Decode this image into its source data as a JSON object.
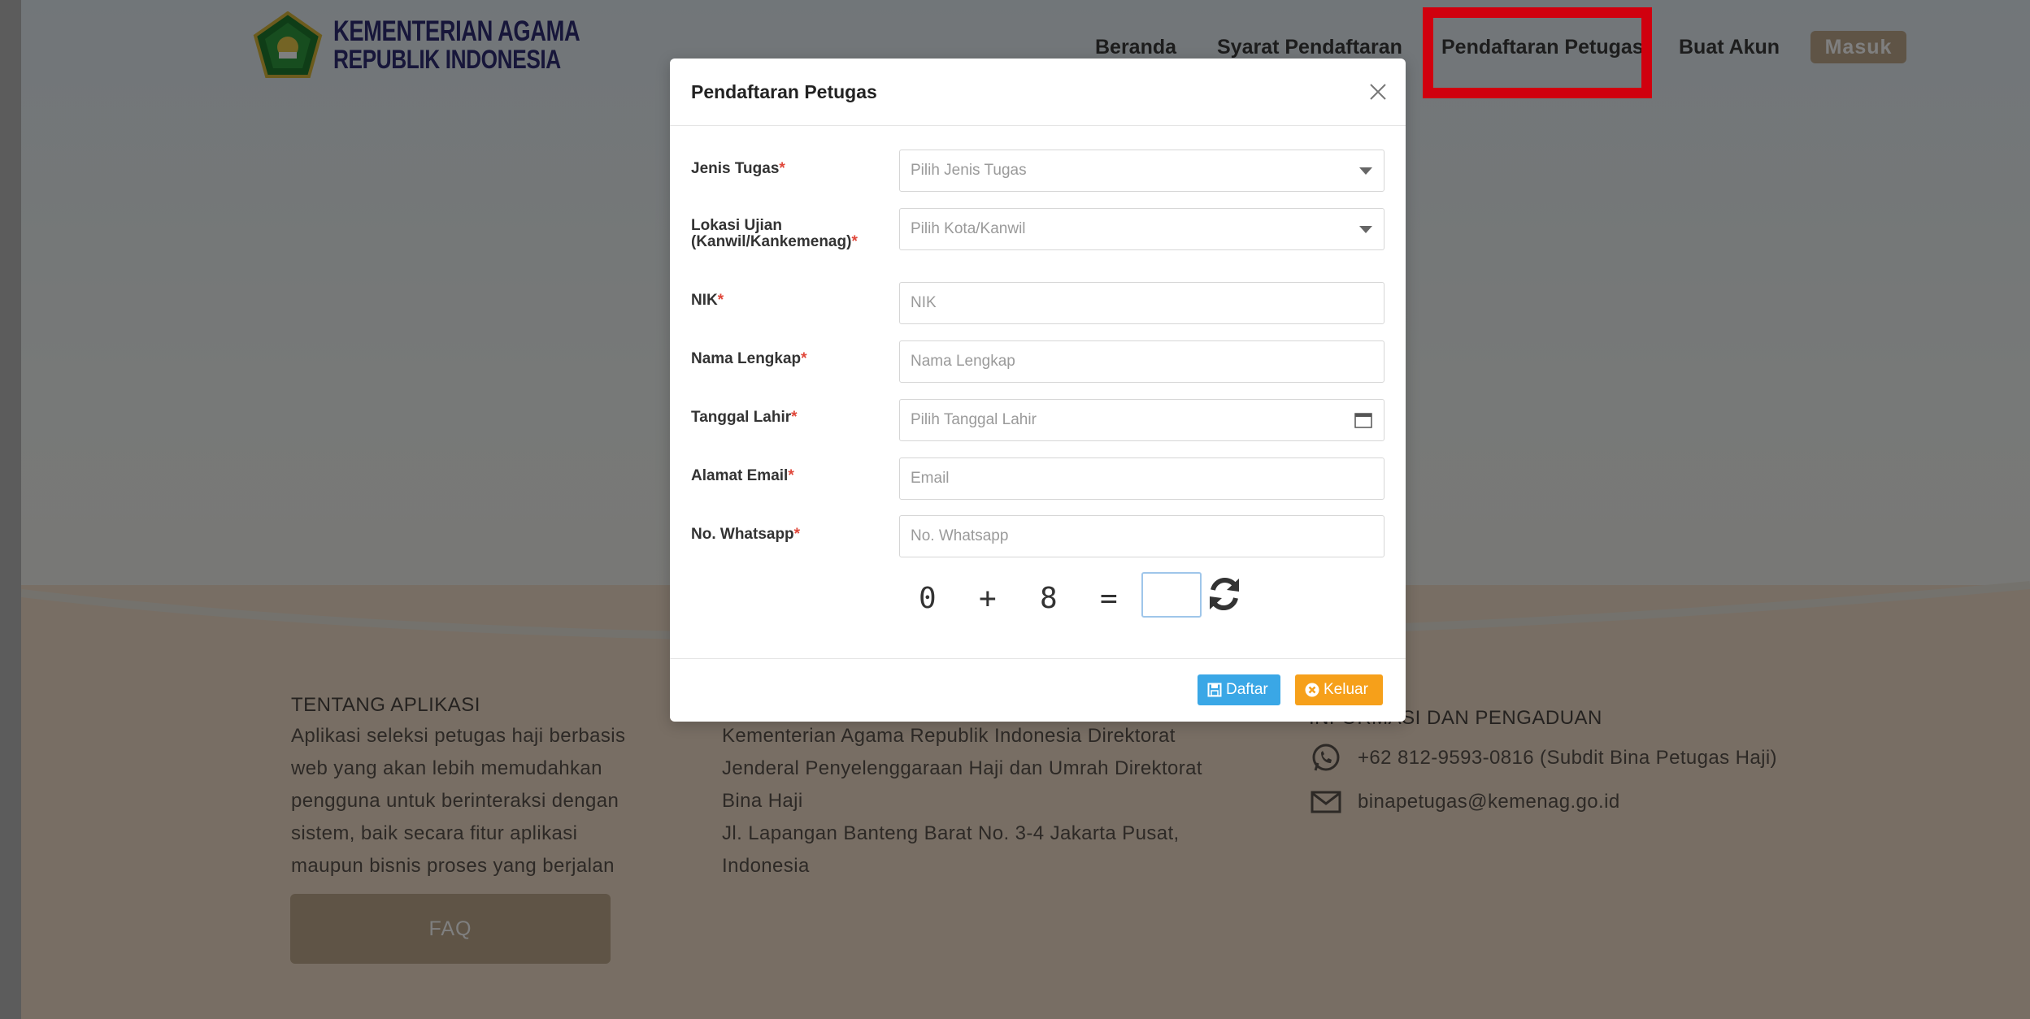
{
  "header": {
    "logo_line1": "KEMENTERIAN AGAMA",
    "logo_line2": "REPUBLIK INDONESIA",
    "nav": {
      "beranda": "Beranda",
      "syarat": "Syarat Pendaftaran",
      "pendaftaran_petugas": "Pendaftaran Petugas",
      "buat_akun": "Buat Akun",
      "masuk": "Masuk"
    }
  },
  "footer": {
    "about_title": "TENTANG APLIKASI",
    "about_lines": [
      "Aplikasi seleksi petugas haji berbasis",
      "web yang akan lebih memudahkan",
      "pengguna untuk berinteraksi dengan",
      "sistem, baik secara fitur aplikasi",
      "maupun bisnis proses yang berjalan"
    ],
    "address_lines": [
      "Kementerian Agama Republik Indonesia Direktorat",
      "Jenderal Penyelenggaraan Haji dan Umrah Direktorat",
      "Bina Haji",
      "Jl. Lapangan Banteng Barat No. 3-4 Jakarta Pusat,",
      "Indonesia"
    ],
    "info_title": "INFORMASI DAN PENGADUAN",
    "phone": "+62 812-9593-0816 (Subdit Bina Petugas Haji)",
    "email": "binapetugas@kemenag.go.id",
    "faq": "FAQ"
  },
  "modal": {
    "title": "Pendaftaran Petugas",
    "required_mark": "*",
    "fields": {
      "jenis_tugas": {
        "label": "Jenis Tugas",
        "placeholder": "Pilih Jenis Tugas"
      },
      "lokasi": {
        "label_line1": "Lokasi Ujian",
        "label_line2": "(Kanwil/Kankemenag)",
        "placeholder": "Pilih Kota/Kanwil"
      },
      "nik": {
        "label": "NIK",
        "placeholder": "NIK"
      },
      "nama": {
        "label": "Nama Lengkap",
        "placeholder": "Nama Lengkap"
      },
      "tanggal": {
        "label": "Tanggal Lahir",
        "placeholder": "Pilih Tanggal Lahir"
      },
      "email": {
        "label": "Alamat Email",
        "placeholder": "Email"
      },
      "whatsapp": {
        "label": "No. Whatsapp",
        "placeholder": "No. Whatsapp"
      }
    },
    "captcha": {
      "a": "0",
      "op": "+",
      "b": "8",
      "eq": "=",
      "answer": ""
    },
    "buttons": {
      "daftar": "Daftar",
      "keluar": "Keluar"
    }
  },
  "colors": {
    "accent_brown": "#bfa88c",
    "daftar_blue": "#3aa7e6",
    "keluar_orange": "#f6a01a",
    "highlight_red": "#d0000e",
    "logo_navy": "#2f2d74"
  }
}
